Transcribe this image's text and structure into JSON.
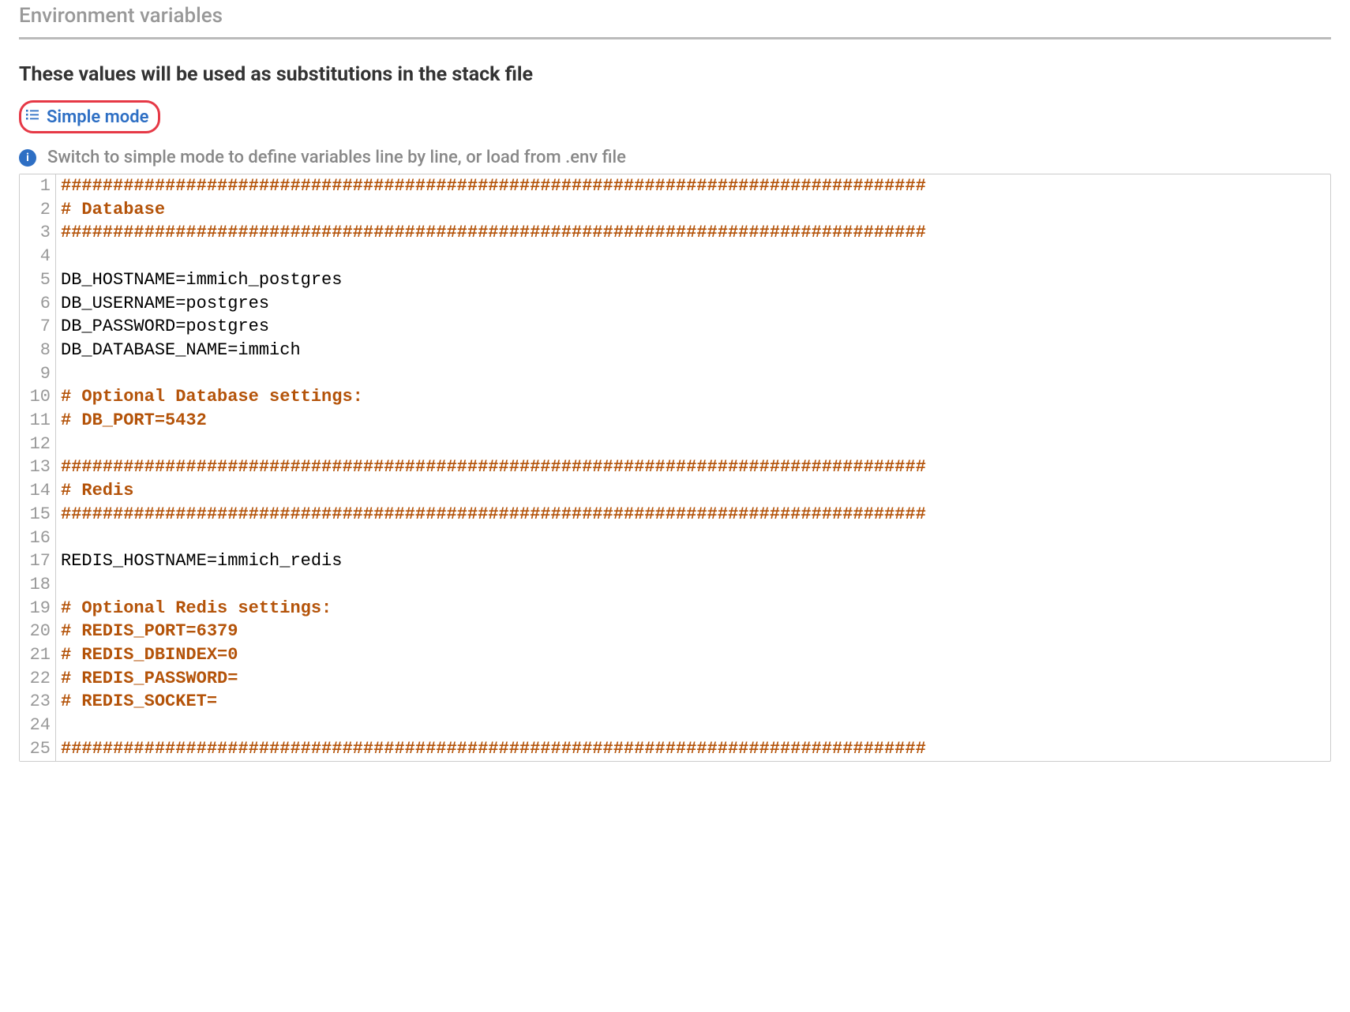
{
  "section_title": "Environment variables",
  "description": "These values will be used as substitutions in the stack file",
  "mode_toggle_label": "Simple mode",
  "info_text": "Switch to simple mode to define variables line by line, or load from .env file",
  "colors": {
    "accent": "#2e6fc4",
    "highlight_border": "#e63946",
    "comment": "#b4530a"
  },
  "editor_lines": [
    {
      "n": 1,
      "type": "comment",
      "text": "###################################################################################"
    },
    {
      "n": 2,
      "type": "comment",
      "text": "# Database"
    },
    {
      "n": 3,
      "type": "comment",
      "text": "###################################################################################"
    },
    {
      "n": 4,
      "type": "plain",
      "text": ""
    },
    {
      "n": 5,
      "type": "plain",
      "text": "DB_HOSTNAME=immich_postgres"
    },
    {
      "n": 6,
      "type": "plain",
      "text": "DB_USERNAME=postgres"
    },
    {
      "n": 7,
      "type": "plain",
      "text": "DB_PASSWORD=postgres"
    },
    {
      "n": 8,
      "type": "plain",
      "text": "DB_DATABASE_NAME=immich"
    },
    {
      "n": 9,
      "type": "plain",
      "text": ""
    },
    {
      "n": 10,
      "type": "comment",
      "text": "# Optional Database settings:"
    },
    {
      "n": 11,
      "type": "comment",
      "text": "# DB_PORT=5432"
    },
    {
      "n": 12,
      "type": "plain",
      "text": ""
    },
    {
      "n": 13,
      "type": "comment",
      "text": "###################################################################################"
    },
    {
      "n": 14,
      "type": "comment",
      "text": "# Redis"
    },
    {
      "n": 15,
      "type": "comment",
      "text": "###################################################################################"
    },
    {
      "n": 16,
      "type": "plain",
      "text": ""
    },
    {
      "n": 17,
      "type": "plain",
      "text": "REDIS_HOSTNAME=immich_redis"
    },
    {
      "n": 18,
      "type": "plain",
      "text": ""
    },
    {
      "n": 19,
      "type": "comment",
      "text": "# Optional Redis settings:"
    },
    {
      "n": 20,
      "type": "comment",
      "text": "# REDIS_PORT=6379"
    },
    {
      "n": 21,
      "type": "comment",
      "text": "# REDIS_DBINDEX=0"
    },
    {
      "n": 22,
      "type": "comment",
      "text": "# REDIS_PASSWORD="
    },
    {
      "n": 23,
      "type": "comment",
      "text": "# REDIS_SOCKET="
    },
    {
      "n": 24,
      "type": "plain",
      "text": ""
    },
    {
      "n": 25,
      "type": "comment",
      "text": "###################################################################################"
    }
  ]
}
